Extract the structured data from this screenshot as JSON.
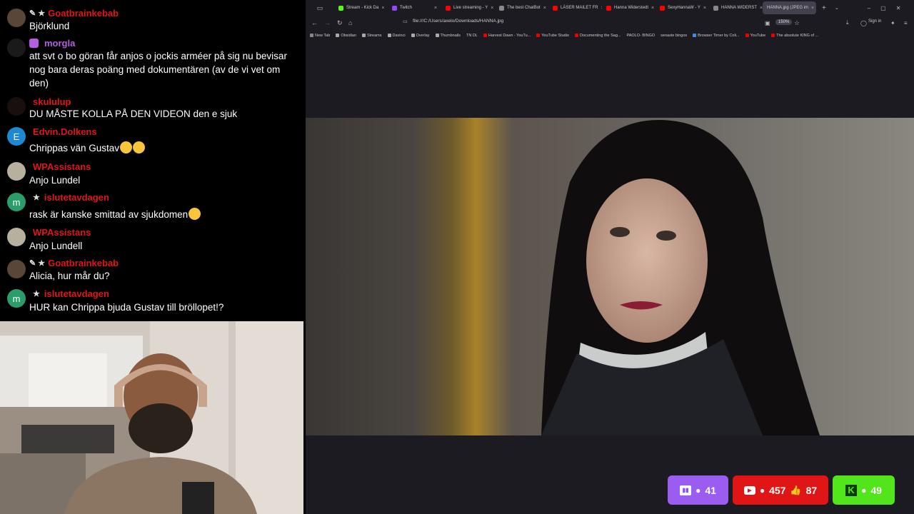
{
  "chat": {
    "messages": [
      {
        "user": "Goatbrainkebab",
        "color": "#e0161b",
        "badges": "✎ ★",
        "text": "Björklund",
        "avatar": "#5a4636",
        "avatar_letter": ""
      },
      {
        "user": "morgla",
        "color": "#b65ee0",
        "badges": "",
        "text": "att svt o bo göran får anjos o jockis arméer på sig nu bevisar nog bara deras poäng med dokumentären (av de vi vet om den)",
        "avatar": "#1a1a1a",
        "avatar_letter": ""
      },
      {
        "user": "skululup",
        "color": "#e0161b",
        "badges": "",
        "text": "DU MÅSTE KOLLA PÅ DEN VIDEON den e sjuk",
        "avatar": "#1a0f0f",
        "avatar_letter": ""
      },
      {
        "user": "Edvin.Dolkens",
        "color": "#e0161b",
        "badges": "",
        "text": "Chrippas vän Gustav",
        "avatar": "#1e88d0",
        "avatar_letter": "E"
      },
      {
        "user": "WPAssistans",
        "color": "#e0161b",
        "badges": "",
        "text": "Anjo Lundel",
        "avatar": "#b8b09e",
        "avatar_letter": ""
      },
      {
        "user": "islutetavdagen",
        "color": "#e0161b",
        "badges": "★",
        "text": "rask är kanske smittad av sjukdomen",
        "avatar": "#2a9d6a",
        "avatar_letter": "m"
      },
      {
        "user": "WPAssistans",
        "color": "#e0161b",
        "badges": "",
        "text": "Anjo Lundell",
        "avatar": "#b8b09e",
        "avatar_letter": ""
      },
      {
        "user": "Goatbrainkebab",
        "color": "#e0161b",
        "badges": "✎ ★",
        "text": "Alicia, hur mår du?",
        "avatar": "#5a4636",
        "avatar_letter": ""
      },
      {
        "user": "islutetavdagen",
        "color": "#e0161b",
        "badges": "★",
        "text": "HUR kan Chrippa bjuda Gustav till bröllopet!?",
        "avatar": "#2a9d6a",
        "avatar_letter": "m"
      }
    ]
  },
  "browser": {
    "tabs": [
      {
        "label": "Stream - Kick Da",
        "color": "#53fc18"
      },
      {
        "label": "Twitch",
        "color": "#9146ff"
      },
      {
        "label": "Live streaming - Y",
        "color": "#ff0000"
      },
      {
        "label": "The best ChatBot",
        "color": "#888888"
      },
      {
        "label": "LÄSER MAILET FR",
        "color": "#ff0000"
      },
      {
        "label": "Hanna Widerstedt",
        "color": "#ff0000"
      },
      {
        "label": "SexyHannaW - Y",
        "color": "#ff0000"
      },
      {
        "label": "HANNA WIDERST",
        "color": "#888888"
      },
      {
        "label": "HANNA.jpg (JPEG im",
        "color": "#888888"
      }
    ],
    "url": "file:///C:/Users/axelo/Downloads/HANNA.jpg",
    "zoom": "150%",
    "sign_in": "Sign in",
    "bookmarks": [
      "New Tab",
      "Obsidian",
      "Streams",
      "Davinci",
      "Overlay",
      "Thumbnails",
      "TN DL",
      "Harvest Dawn - YouTu...",
      "YouTube Studio",
      "Documenting the Sag...",
      "PAOLO- BINGO",
      "senaste bingos",
      "Browser Timer by Coli...",
      "YouTube",
      "The absolute KING of ..."
    ]
  },
  "stats": {
    "twitch_viewers": "41",
    "youtube_viewers": "457",
    "youtube_likes": "87",
    "kick_viewers": "49"
  },
  "colors": {
    "twitch": "#9146ff",
    "youtube": "#e01515",
    "kick": "#53e51c"
  }
}
